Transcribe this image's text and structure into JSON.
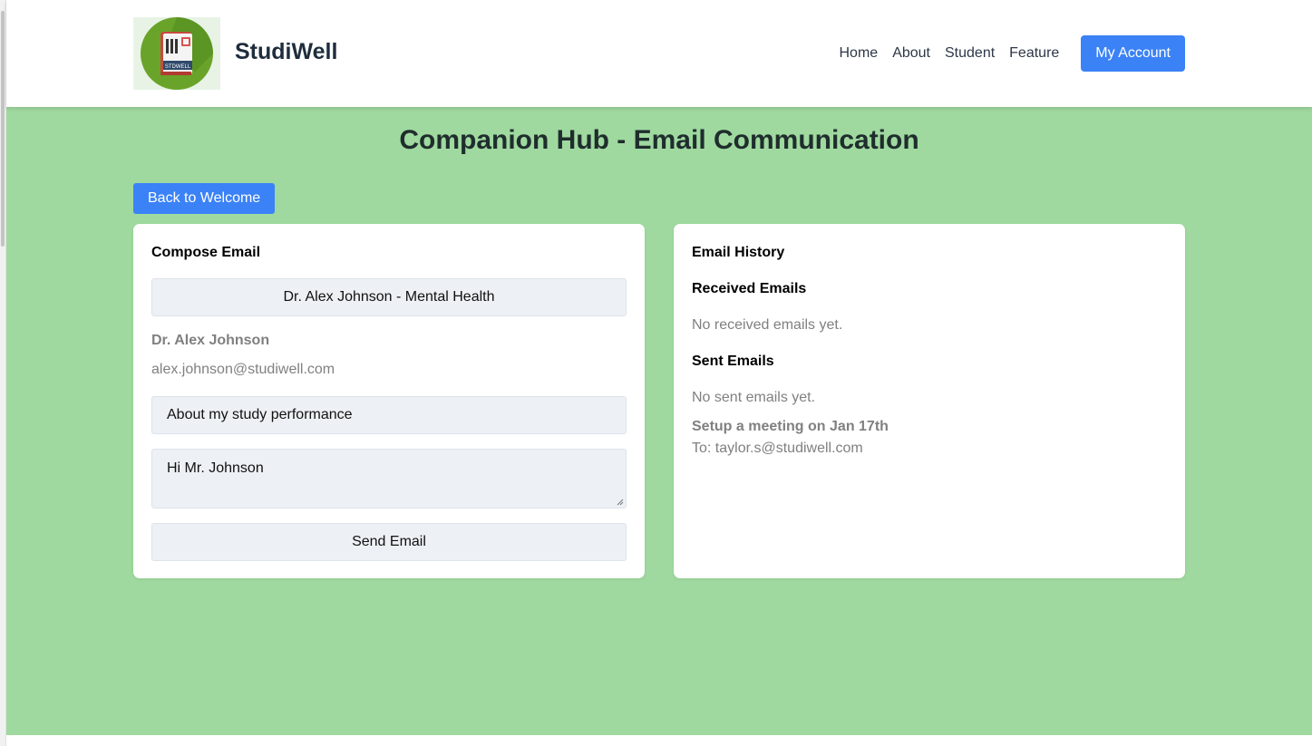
{
  "header": {
    "logo_text": "STDWELL",
    "brand": "StudiWell",
    "nav": [
      {
        "label": "Home"
      },
      {
        "label": "About"
      },
      {
        "label": "Student"
      },
      {
        "label": "Feature"
      }
    ],
    "account_button": "My Account"
  },
  "main": {
    "title": "Companion Hub - Email Communication",
    "back_button": "Back to Welcome"
  },
  "compose": {
    "title": "Compose Email",
    "recipient_selected": "Dr. Alex Johnson - Mental Health",
    "recipient_name": "Dr. Alex Johnson",
    "recipient_email": "alex.johnson@studiwell.com",
    "subject_value": "About my study performance",
    "message_value": "Hi Mr. Johnson",
    "send_button": "Send Email"
  },
  "history": {
    "title": "Email History",
    "received_title": "Received Emails",
    "received_empty": "No received emails yet.",
    "sent_title": "Sent Emails",
    "sent_empty": "No sent emails yet.",
    "sent_items": [
      {
        "subject": "Setup a meeting on Jan 17th",
        "to": "To: taylor.s@studiwell.com"
      }
    ]
  },
  "colors": {
    "accent": "#3b82f6",
    "background": "#9fd99f",
    "card": "#ffffff",
    "field": "#edf1f5"
  }
}
